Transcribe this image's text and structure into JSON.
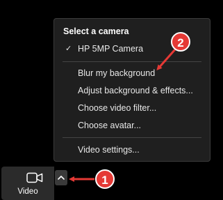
{
  "menu": {
    "header": "Select a camera",
    "camera": {
      "label": "HP 5MP Camera",
      "checked": true,
      "check_glyph": "✓"
    },
    "options": [
      {
        "label": "Blur my background"
      },
      {
        "label": "Adjust background & effects..."
      },
      {
        "label": "Choose video filter..."
      },
      {
        "label": "Choose avatar..."
      }
    ],
    "settings": {
      "label": "Video settings..."
    }
  },
  "toolbar": {
    "video_label": "Video",
    "video_icon": "video-camera-icon",
    "caret_icon": "chevron-up-icon"
  },
  "annotations": {
    "badge1": "1",
    "badge2": "2",
    "color": "#e53935"
  }
}
